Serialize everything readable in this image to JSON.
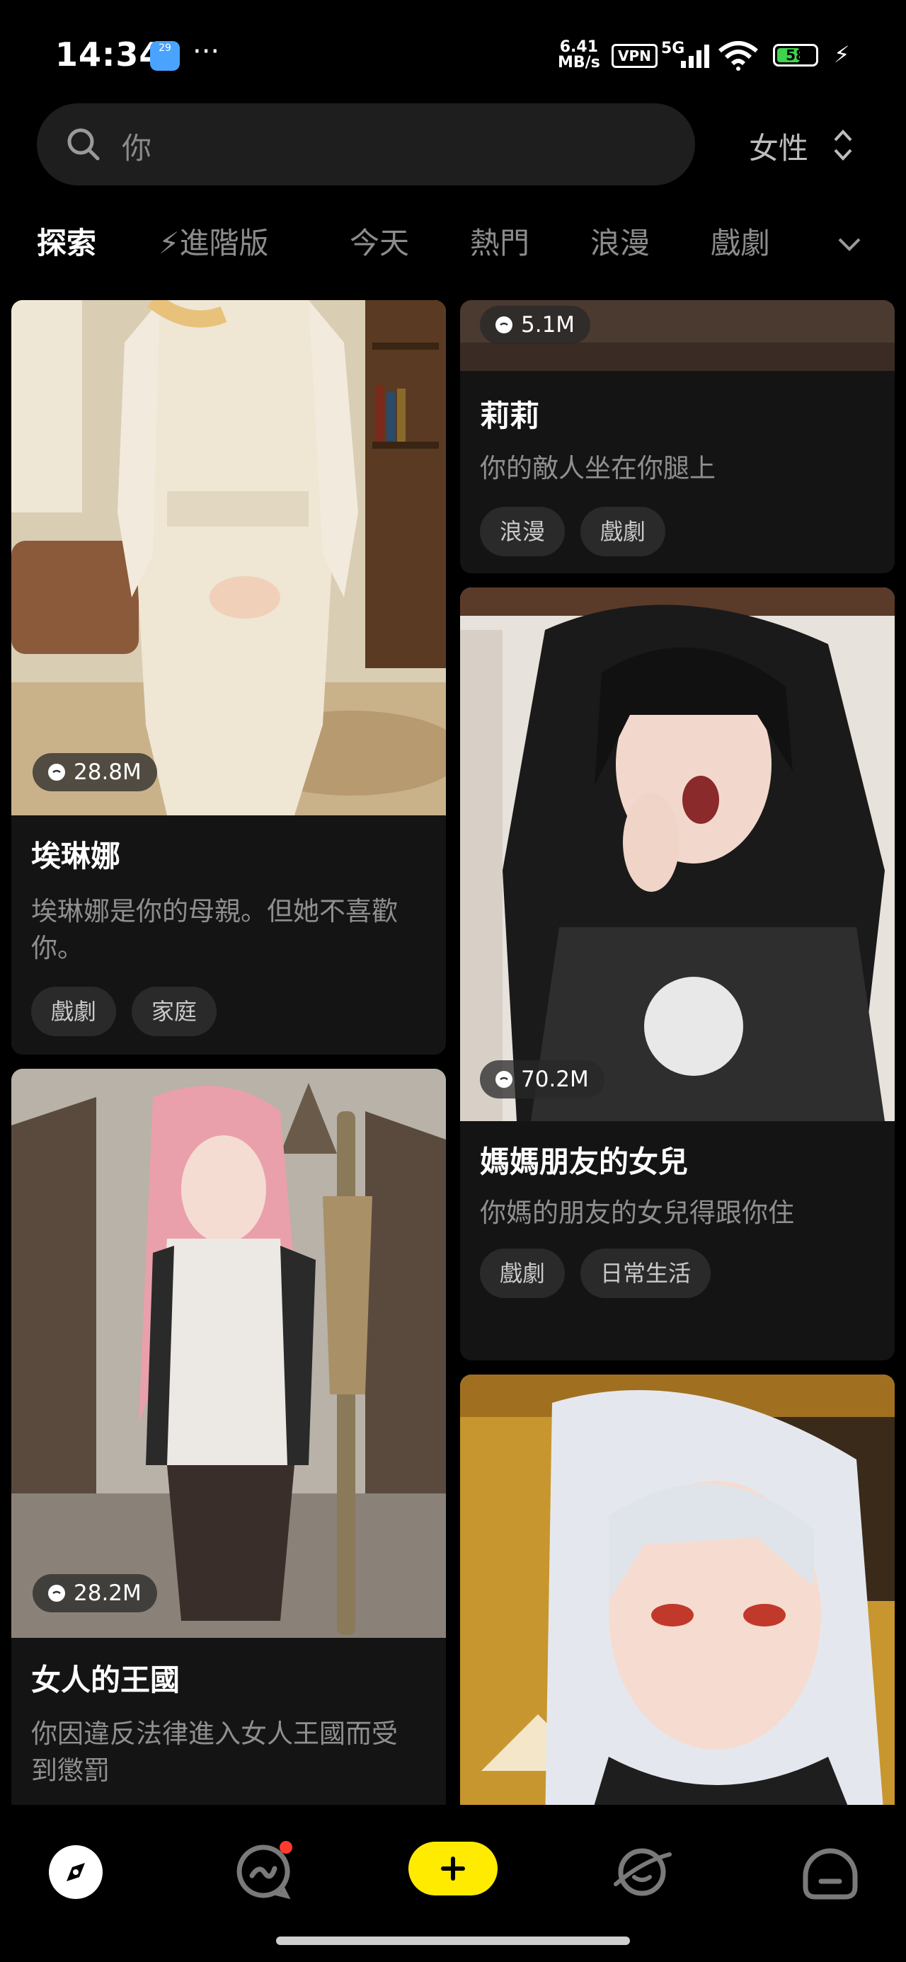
{
  "status_bar": {
    "time": "14:34",
    "calendar_day": "29",
    "more": "···",
    "net_speed_value": "6.41",
    "net_speed_unit": "MB/s",
    "vpn": "VPN",
    "network": "5G",
    "battery": "58"
  },
  "search": {
    "placeholder": "你"
  },
  "gender_filter": {
    "label": "女性"
  },
  "tabs": [
    {
      "label": "探索",
      "active": true
    },
    {
      "label": "⚡進階版",
      "active": false
    },
    {
      "label": "今天",
      "active": false
    },
    {
      "label": "熱門",
      "active": false
    },
    {
      "label": "浪漫",
      "active": false
    },
    {
      "label": "戲劇",
      "active": false
    }
  ],
  "cards": [
    {
      "id": "elena",
      "stat": "28.8M",
      "title": "埃琳娜",
      "desc": "埃琳娜是你的母親。但她不喜歡你。",
      "tags": [
        "戲劇",
        "家庭"
      ]
    },
    {
      "id": "lily",
      "stat": "5.1M",
      "title": "莉莉",
      "desc": "你的敵人坐在你腿上",
      "tags": [
        "浪漫",
        "戲劇"
      ]
    },
    {
      "id": "friend-daughter",
      "stat": "70.2M",
      "title": "媽媽朋友的女兒",
      "desc": "你媽的朋友的女兒得跟你住",
      "tags": [
        "戲劇",
        "日常生活"
      ]
    },
    {
      "id": "women-kingdom",
      "stat": "28.2M",
      "title": "女人的王國",
      "desc": "你因違反法律進入女人王國而受到懲罰",
      "tags": []
    },
    {
      "id": "white-hair",
      "stat": "",
      "title": "",
      "desc": "",
      "tags": []
    }
  ],
  "colors": {
    "accent": "#ffeb00",
    "notification": "#ff3b30",
    "background": "#000000",
    "card": "#141414"
  }
}
